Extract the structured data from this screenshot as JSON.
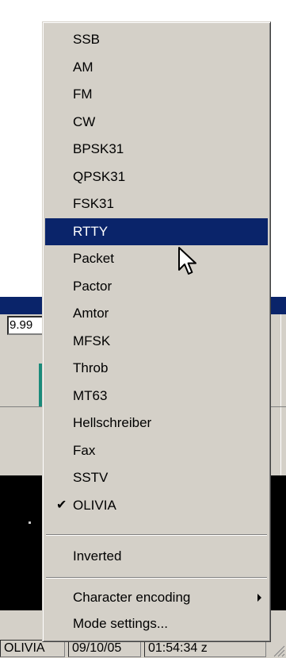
{
  "app": {
    "frequency_value": "9.99",
    "status_bar": {
      "mode": "OLIVIA",
      "date": "09/10/05",
      "time": "01:54:34 z"
    }
  },
  "menu": {
    "modes": [
      {
        "label": "SSB",
        "checked": false,
        "selected": false
      },
      {
        "label": "AM",
        "checked": false,
        "selected": false
      },
      {
        "label": "FM",
        "checked": false,
        "selected": false
      },
      {
        "label": "CW",
        "checked": false,
        "selected": false
      },
      {
        "label": "BPSK31",
        "checked": false,
        "selected": false
      },
      {
        "label": "QPSK31",
        "checked": false,
        "selected": false
      },
      {
        "label": "FSK31",
        "checked": false,
        "selected": false
      },
      {
        "label": "RTTY",
        "checked": false,
        "selected": true
      },
      {
        "label": "Packet",
        "checked": false,
        "selected": false
      },
      {
        "label": "Pactor",
        "checked": false,
        "selected": false
      },
      {
        "label": "Amtor",
        "checked": false,
        "selected": false
      },
      {
        "label": "MFSK",
        "checked": false,
        "selected": false
      },
      {
        "label": "Throb",
        "checked": false,
        "selected": false
      },
      {
        "label": "MT63",
        "checked": false,
        "selected": false
      },
      {
        "label": "Hellschreiber",
        "checked": false,
        "selected": false
      },
      {
        "label": "Fax",
        "checked": false,
        "selected": false
      },
      {
        "label": "SSTV",
        "checked": false,
        "selected": false
      },
      {
        "label": "OLIVIA",
        "checked": true,
        "selected": false
      }
    ],
    "inverted_label": "Inverted",
    "character_encoding_label": "Character encoding",
    "mode_settings_label": "Mode settings...",
    "check_glyph": "✔"
  },
  "colors": {
    "selection": "#0a246a",
    "menu_face": "#d4d0c8"
  },
  "icons": {
    "cursor": "arrow-pointer-icon",
    "submenu": "submenu-arrow-icon",
    "check": "checkmark-icon"
  }
}
